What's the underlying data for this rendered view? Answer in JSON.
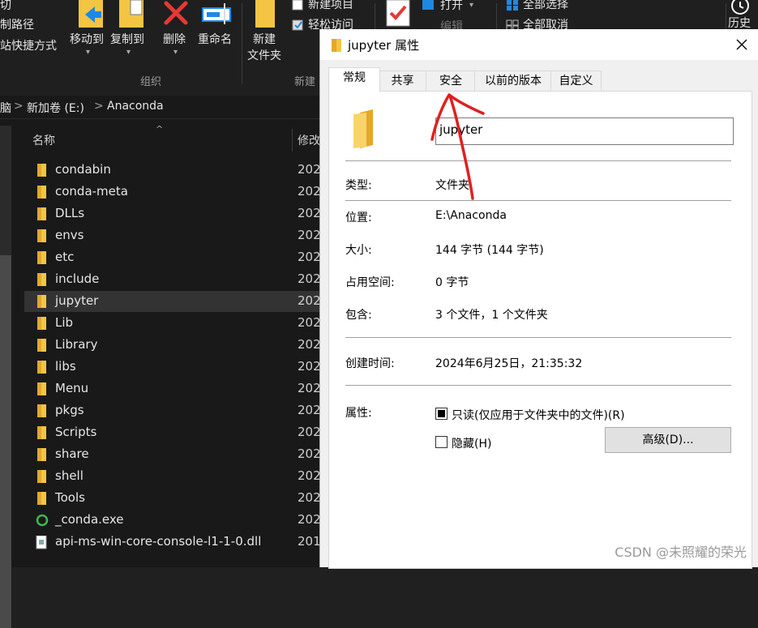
{
  "ribbon": {
    "top_left_partial": "切",
    "copy_path": "制路径",
    "paste_shortcut": "站快捷方式",
    "move_to": "移动到",
    "copy_to": "复制到",
    "delete": "删除",
    "rename": "重命名",
    "group_organize": "组织",
    "new_folder_line1": "新建",
    "new_folder_line2": "文件夹",
    "new_item": "新建项目",
    "easy_access": "轻松访问",
    "group_new": "新建",
    "open": "打开",
    "edit_partial": "编辑",
    "select_all": "全部选择",
    "select_none": "全部取消",
    "history_partial": "历史"
  },
  "address": {
    "partial": "脑",
    "drive": "新加卷 (E:)",
    "folder": "Anaconda",
    "chevron": ">"
  },
  "columns": {
    "name": "名称",
    "modified_partial": "修改"
  },
  "files": [
    {
      "name": "condabin",
      "date": "202",
      "type": "folder"
    },
    {
      "name": "conda-meta",
      "date": "202",
      "type": "folder"
    },
    {
      "name": "DLLs",
      "date": "202",
      "type": "folder"
    },
    {
      "name": "envs",
      "date": "202",
      "type": "folder"
    },
    {
      "name": "etc",
      "date": "202",
      "type": "folder"
    },
    {
      "name": "include",
      "date": "202",
      "type": "folder"
    },
    {
      "name": "jupyter",
      "date": "202",
      "type": "folder"
    },
    {
      "name": "Lib",
      "date": "202",
      "type": "folder"
    },
    {
      "name": "Library",
      "date": "202",
      "type": "folder"
    },
    {
      "name": "libs",
      "date": "202",
      "type": "folder"
    },
    {
      "name": "Menu",
      "date": "202",
      "type": "folder"
    },
    {
      "name": "pkgs",
      "date": "202",
      "type": "folder"
    },
    {
      "name": "Scripts",
      "date": "202",
      "type": "folder"
    },
    {
      "name": "share",
      "date": "202",
      "type": "folder"
    },
    {
      "name": "shell",
      "date": "202",
      "type": "folder"
    },
    {
      "name": "Tools",
      "date": "202",
      "type": "folder"
    },
    {
      "name": "_conda.exe",
      "date": "202",
      "type": "exe"
    },
    {
      "name": "api-ms-win-core-console-l1-1-0.dll",
      "date": "201",
      "type": "dll"
    }
  ],
  "selected_file": "jupyter",
  "dialog": {
    "title": "jupyter 属性",
    "tabs": [
      "常规",
      "共享",
      "安全",
      "以前的版本",
      "自定义"
    ],
    "active_tab": "常规",
    "folder_name": "jupyter",
    "type_label": "类型:",
    "type_value": "文件夹",
    "location_label": "位置:",
    "location_value": "E:\\Anaconda",
    "size_label": "大小:",
    "size_value": "144 字节 (144 字节)",
    "size_on_disk_label": "占用空间:",
    "size_on_disk_value": "0 字节",
    "contains_label": "包含:",
    "contains_value": "3 个文件，1 个文件夹",
    "created_label": "创建时间:",
    "created_value": "2024年6月25日，21:35:32",
    "attributes_label": "属性:",
    "readonly_label": "只读(仅应用于文件夹中的文件)(R)",
    "readonly_checked": true,
    "hidden_label": "隐藏(H)",
    "hidden_checked": false,
    "advanced_button": "高级(D)..."
  },
  "watermark": "CSDN @未照耀的荣光",
  "colors": {
    "annotation_red": "#e02020",
    "folder_yellow": "#f4c542",
    "explorer_bg": "#191919",
    "dialog_bg": "#f0f0f0"
  }
}
